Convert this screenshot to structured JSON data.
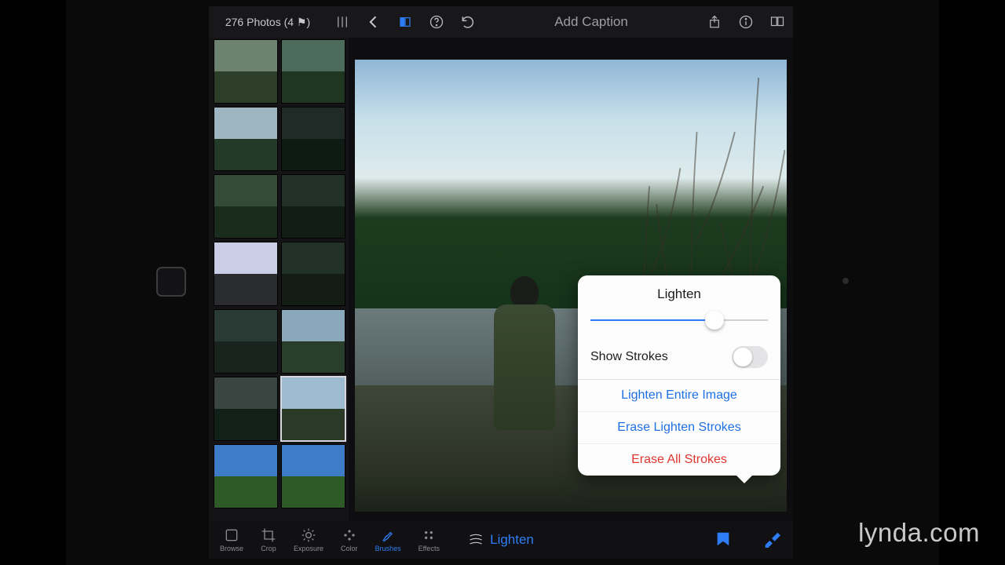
{
  "topbar": {
    "photo_count": "276 Photos (4 ⚑)",
    "caption_placeholder": "Add Caption"
  },
  "thumbnails": [
    {
      "sky": "#6e8270",
      "ground": "#2d3e28"
    },
    {
      "sky": "#4d6b5d",
      "ground": "#1f3620"
    },
    {
      "sky": "#9db6c2",
      "ground": "#243a28"
    },
    {
      "sky": "#202a26",
      "ground": "#0e1a14"
    },
    {
      "sky": "#344b38",
      "ground": "#1a2c1b"
    },
    {
      "sky": "#22322a",
      "ground": "#101c14"
    },
    {
      "sky": "#c9cde6",
      "ground": "#2a2c30"
    },
    {
      "sky": "#223228",
      "ground": "#141c16"
    },
    {
      "sky": "#2a3a34",
      "ground": "#1a241e"
    },
    {
      "sky": "#8aa8bc",
      "ground": "#2a3e2c"
    },
    {
      "sky": "#3a4440",
      "ground": "#12201a",
      "selected": false
    },
    {
      "sky": "#9cbad0",
      "ground": "#2a3a26",
      "selected": true
    },
    {
      "sky": "#3d7dc8",
      "ground": "#2e5a28"
    },
    {
      "sky": "#3d7dc8",
      "ground": "#2e5a28"
    }
  ],
  "tools": [
    {
      "id": "browse",
      "label": "Browse"
    },
    {
      "id": "crop",
      "label": "Crop"
    },
    {
      "id": "exposure",
      "label": "Exposure"
    },
    {
      "id": "color",
      "label": "Color"
    },
    {
      "id": "brushes",
      "label": "Brushes",
      "active": true
    },
    {
      "id": "effects",
      "label": "Effects"
    }
  ],
  "current_brush": {
    "label": "Lighten"
  },
  "popover": {
    "title": "Lighten",
    "slider_value": 0.7,
    "show_strokes_label": "Show Strokes",
    "show_strokes_on": false,
    "actions": {
      "lighten_entire": "Lighten Entire Image",
      "erase_lighten": "Erase Lighten Strokes",
      "erase_all": "Erase All Strokes"
    }
  },
  "watermark": "lynda.com"
}
